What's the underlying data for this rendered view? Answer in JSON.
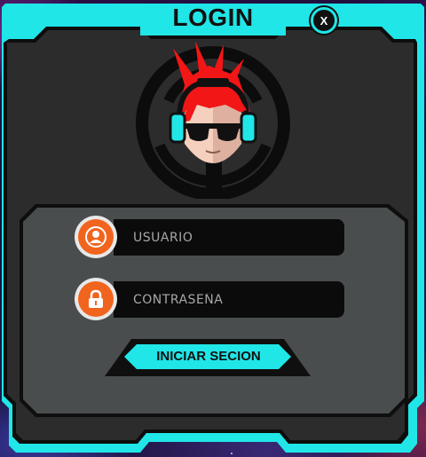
{
  "window": {
    "title": "LOGIN",
    "close_label": "X"
  },
  "form": {
    "username_placeholder": "USUARIO",
    "password_placeholder": "CONTRASEÑA",
    "submit_label": "INICIAR SECION"
  },
  "icons": {
    "close": "close-icon",
    "user": "user-icon",
    "lock": "lock-icon",
    "avatar": "avatar-icon"
  },
  "colors": {
    "accent": "#20e6e8",
    "panel": "#2b2b2b",
    "inner_panel": "#4a4d4e",
    "field": "#0b0b0b",
    "icon_bg": "#f1641d",
    "avatar_hair": "#f21616"
  }
}
